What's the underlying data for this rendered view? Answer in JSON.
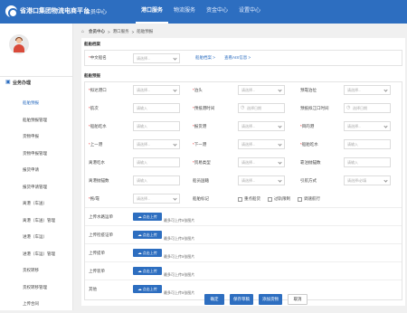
{
  "header": {
    "brand": "省港口集团物流电商平台",
    "sub": "会员中心",
    "nav": [
      "港口服务",
      "物流服务",
      "资金中心",
      "设置中心"
    ]
  },
  "sidebar": {
    "section": "业务办理",
    "items": [
      "船舶预报",
      "船舶预报管理",
      "货物申报",
      "货物申报管理",
      "报货申请",
      "报货申请管理",
      "离港（车送）",
      "离港（车送）管理",
      "进港（车运）",
      "进港（车运）管理",
      "货权转移",
      "货权转移管理",
      "上传合同"
    ]
  },
  "breadcrumb": [
    "会员中心",
    "港口服务",
    "船舶预报"
  ],
  "section1": {
    "title": "船舶档案",
    "label": "中文船名",
    "placeholder": "请选择...",
    "link1": "船舶档案 >",
    "link2": "查看AIS信息 >"
  },
  "section2": {
    "title": "船舶预报",
    "fields": {
      "load_port": "拟达港口",
      "berth": "泊头",
      "expected_berth": "预靠泊位",
      "voyage": "航次",
      "eta": "预抵港时间",
      "etd": "预抵拟江口时间",
      "draft": "船舶吃水",
      "consignor": "报货港",
      "dest_port": "目的港",
      "prev_port": "上一港",
      "next_port": "下一港",
      "pilot": "船舶吃水",
      "arr_draft": "离港吃水",
      "trade_type": "贸易类型",
      "side_type": "靠泊抛锚数",
      "fore_draft": "离港抛锚数",
      "ship_country": "船员国籍",
      "tow": "引航方式",
      "tug": "拖/靠",
      "mark": "船舶标记"
    },
    "select_ph": "请选择...",
    "input_ph": "请输入",
    "date_ph": "选择日期",
    "tow_ph": "请选择/必填",
    "checks": [
      "重点船货",
      "过轨限制",
      "调速航行"
    ],
    "uploads": [
      {
        "label": "上传水路运单",
        "btn": "点击上传",
        "hint": "最多可上传5张图片"
      },
      {
        "label": "上传检疫证单",
        "btn": "点击上传",
        "hint": "最多可上传5张图片"
      },
      {
        "label": "上传提单",
        "btn": "点击上传",
        "hint": "最多可上传5张图片"
      },
      {
        "label": "上传装单",
        "btn": "点击上传",
        "hint": "最多可上传5张图片"
      },
      {
        "label": "其他",
        "btn": "点击上传",
        "hint": "最多可上传5张图片"
      }
    ]
  },
  "actions": {
    "confirm": "确定",
    "save_draft": "保存草稿",
    "add_ship": "添加货物",
    "cancel": "取消"
  },
  "colors": {
    "primary": "#2d6ec0"
  }
}
